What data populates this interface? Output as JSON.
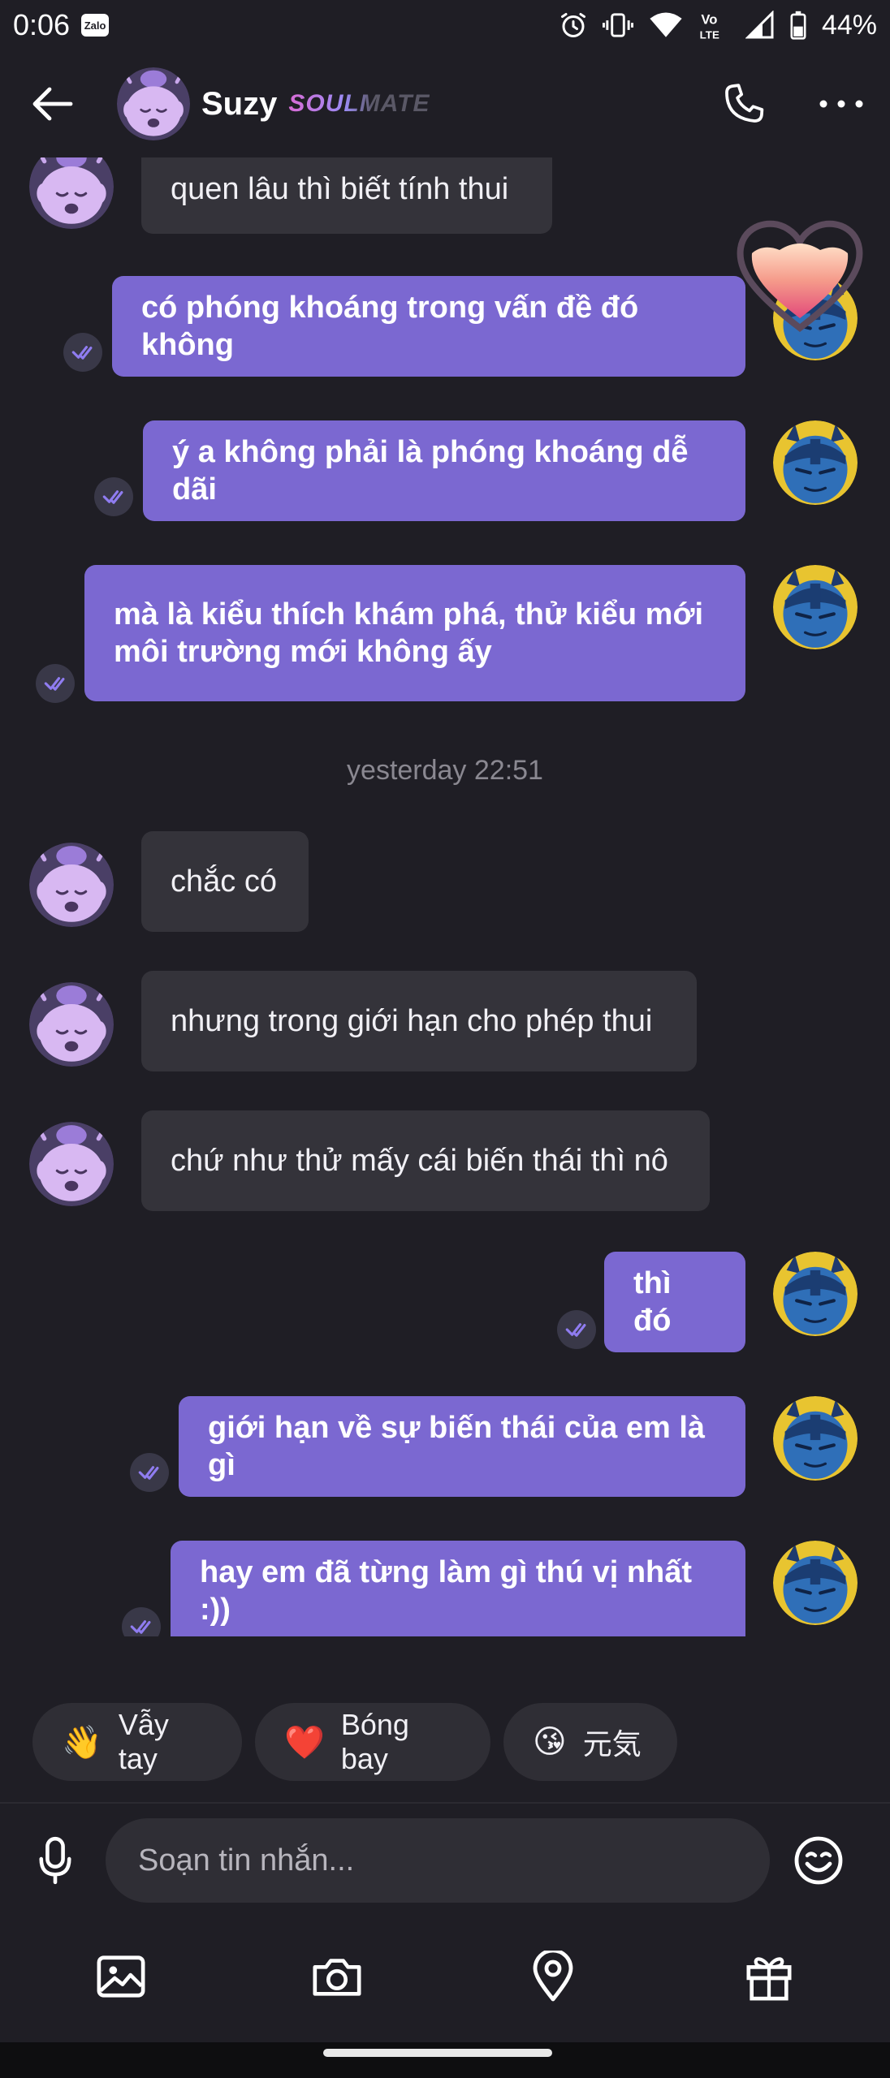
{
  "status_bar": {
    "time": "0:06",
    "zalo_badge": "Zalo",
    "battery": "44%"
  },
  "header": {
    "name": "Suzy",
    "tag": "SOULMATE"
  },
  "messages": [
    {
      "text": "quen lâu thì biết tính thui"
    },
    {
      "text": "có phóng khoáng trong vấn đề đó không"
    },
    {
      "text": "ý a không phải là phóng khoáng dễ dãi"
    },
    {
      "text_line1": "mà là kiểu thích khám phá, thử kiểu mới",
      "text_line2": "môi trường mới không ấy"
    },
    {
      "text": "chắc có"
    },
    {
      "text": "nhưng trong giới hạn cho phép thui"
    },
    {
      "text": "chứ như thử mấy cái biến thái thì nô"
    },
    {
      "text": "thì đó"
    },
    {
      "text": "giới hạn về sự biến thái của em là gì"
    },
    {
      "text": "hay em đã từng làm gì thú vị nhất :))"
    }
  ],
  "timestamp": "yesterday 22:51",
  "quick_replies": [
    {
      "emoji": "👋",
      "label": "Vẫy tay"
    },
    {
      "emoji": "❤️",
      "label": "Bóng bay"
    },
    {
      "emoji": "😘",
      "label": "元気"
    }
  ],
  "composer": {
    "placeholder": "Soạn tin nhắn..."
  },
  "colors": {
    "background": "#1f1e25",
    "incoming_bubble": "#34333a",
    "outgoing_bubble": "#7b68d1"
  }
}
